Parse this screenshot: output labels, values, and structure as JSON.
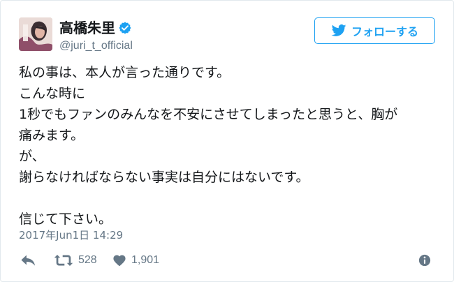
{
  "user": {
    "display_name": "高橋朱里",
    "username": "@juri_t_official",
    "verified": true
  },
  "follow_button": {
    "label": "フォローする"
  },
  "tweet": {
    "lines": [
      "私の事は、本人が言った通りです。",
      "こんな時に",
      "1秒でもファンのみんなを不安にさせてしまったと思うと、胸が",
      "痛みます。",
      "が、",
      "謝らなければならない事実は自分にはないです。",
      "",
      "信じて下さい。"
    ],
    "timestamp": "2017年Jun1日 14:29"
  },
  "actions": {
    "retweet_count": "528",
    "like_count": "1,901"
  },
  "colors": {
    "accent": "#1da1f2",
    "secondary_text": "#657786",
    "primary_text": "#14171a",
    "border": "#e1e8ed"
  }
}
